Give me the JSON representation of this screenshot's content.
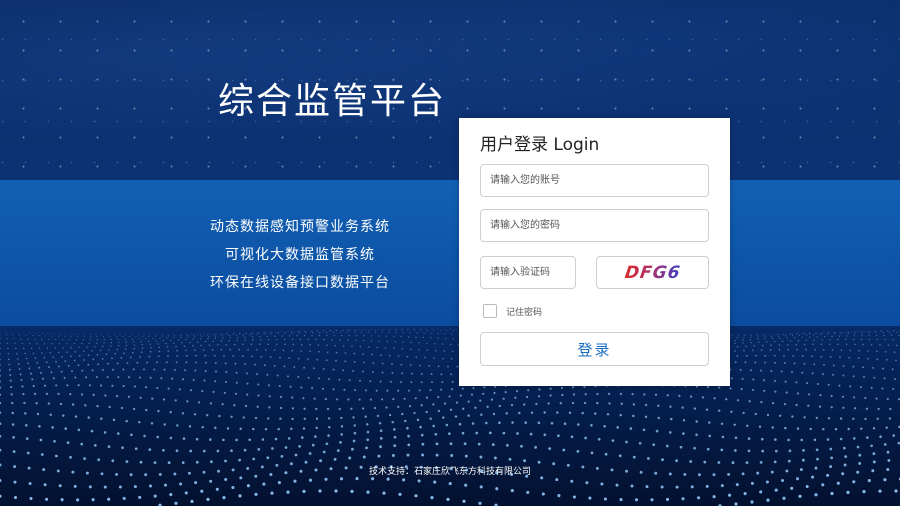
{
  "platform": {
    "title": "综合监管平台",
    "features": [
      "动态数据感知预警业务系统",
      "可视化大数据监管系统",
      "环保在线设备接口数据平台"
    ]
  },
  "login": {
    "title": "用户登录 Login",
    "account_placeholder": "请输入您的账号",
    "password_placeholder": "请输入您的密码",
    "captcha_placeholder": "请输入验证码",
    "captcha_code": "DFG6",
    "remember_label": "记住密码",
    "submit_label": "登录"
  },
  "footer": {
    "text": "技术支持：石家庄欣飞东方科技有限公司"
  },
  "colors": {
    "band_blue": "#1260b4",
    "button_text": "#1a6fc2",
    "background_dark": "#061a44"
  }
}
